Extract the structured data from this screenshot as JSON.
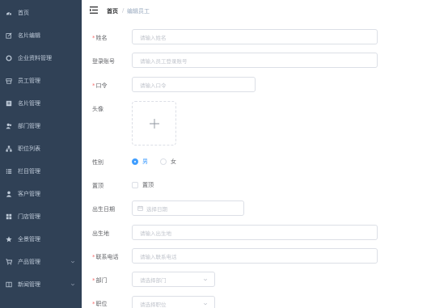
{
  "sidebar": {
    "items": [
      {
        "label": "首页",
        "icon": "dashboard-icon"
      },
      {
        "label": "名片编辑",
        "icon": "edit-icon"
      },
      {
        "label": "企业资料管理",
        "icon": "company-icon"
      },
      {
        "label": "员工管理",
        "icon": "employee-icon"
      },
      {
        "label": "名片管理",
        "icon": "card-icon"
      },
      {
        "label": "部门管理",
        "icon": "department-icon"
      },
      {
        "label": "职位列表",
        "icon": "org-tree-icon"
      },
      {
        "label": "栏目管理",
        "icon": "list-icon"
      },
      {
        "label": "客户管理",
        "icon": "user-icon"
      },
      {
        "label": "门店管理",
        "icon": "grid-icon"
      },
      {
        "label": "全景管理",
        "icon": "star-icon"
      },
      {
        "label": "产品管理",
        "icon": "cart-icon",
        "has_chevron": true
      },
      {
        "label": "新闻管理",
        "icon": "news-icon",
        "has_chevron": true
      }
    ]
  },
  "header": {
    "breadcrumb_home": "首页",
    "breadcrumb_separator": "/",
    "breadcrumb_current": "编辑员工"
  },
  "form": {
    "name": {
      "label": "姓名",
      "required": true,
      "placeholder": "请输入姓名"
    },
    "login": {
      "label": "登录账号",
      "required": false,
      "placeholder": "请输入员工登录账号"
    },
    "password": {
      "label": "口令",
      "required": true,
      "placeholder": "请输入口令"
    },
    "avatar": {
      "label": "头像"
    },
    "gender": {
      "label": "性别",
      "options": [
        "男",
        "女"
      ],
      "selected": "男"
    },
    "top": {
      "label": "置顶",
      "option": "置顶",
      "checked": false
    },
    "birthday": {
      "label": "出生日期",
      "placeholder": "选择日期"
    },
    "birthplace": {
      "label": "出生地",
      "placeholder": "请输入出生地"
    },
    "phone": {
      "label": "联系电话",
      "required": true,
      "placeholder": "请输入联系电话"
    },
    "department": {
      "label": "部门",
      "required": true,
      "placeholder": "请选择部门"
    },
    "position": {
      "label": "职位",
      "required": true,
      "placeholder": "请选择职位"
    }
  },
  "colors": {
    "sidebar_bg": "#304156",
    "sidebar_text": "#bfcbd9",
    "accent": "#409eff",
    "required": "#f56c6c",
    "border": "#dcdfe6",
    "placeholder": "#c0c4cc"
  }
}
